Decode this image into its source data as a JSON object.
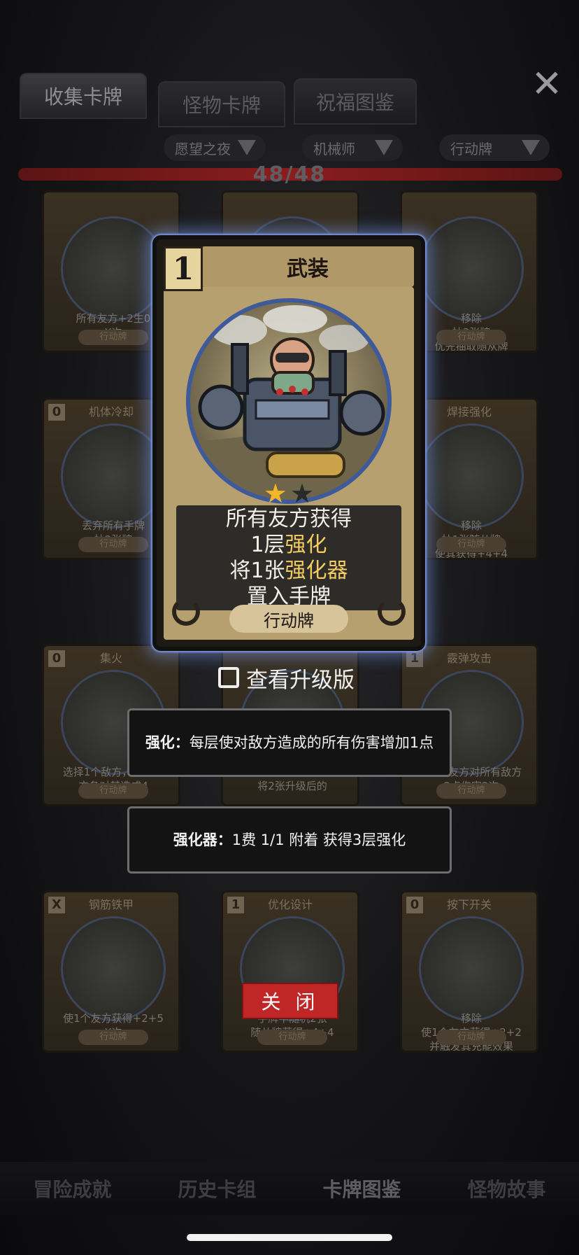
{
  "tabs": [
    {
      "label": "收集卡牌",
      "active": true
    },
    {
      "label": "怪物卡牌",
      "active": false
    },
    {
      "label": "祝福图鉴",
      "active": false
    }
  ],
  "filters": [
    "愿望之夜",
    "机械师",
    "行动牌"
  ],
  "collection_progress": "48/48",
  "background_cards": [
    {
      "cost": "",
      "name": "",
      "text": "所有友方+2生0\nX次",
      "type": "行动牌"
    },
    {
      "cost": "",
      "name": "",
      "text": "",
      "type": ""
    },
    {
      "cost": "",
      "name": "",
      "text": "移除\n抽3张牌\n优先抽取随从牌",
      "type": "行动牌"
    },
    {
      "cost": "0",
      "name": "机体冷却",
      "text": "丢弃所有手牌\n抽2张牌",
      "type": "行动牌"
    },
    {
      "cost": "",
      "name": "",
      "text": "",
      "type": ""
    },
    {
      "cost": "",
      "name": "焊接强化",
      "text": "移除\n抽1张随从牌\n使其获得+4+4",
      "type": "行动牌"
    },
    {
      "cost": "0",
      "name": "集火",
      "text": "选择1个敌方，所有友\n方各对其造成4",
      "type": "行动牌"
    },
    {
      "cost": "",
      "name": "",
      "text": "移除\n将2张升级后的",
      "type": ""
    },
    {
      "cost": "1",
      "name": "霰弹攻击",
      "text": "使1个友方对所有敌方\n2点伤害2次",
      "type": "行动牌"
    },
    {
      "cost": "X",
      "name": "钢筋铁甲",
      "text": "使1个友方获得+2+5\nX次",
      "type": "行动牌"
    },
    {
      "cost": "1",
      "name": "优化设计",
      "text": "手牌中随机2张\n随从牌获得+4+4",
      "type": "行动牌"
    },
    {
      "cost": "0",
      "name": "按下开关",
      "text": "移除\n使1个友方获得+2+2\n并触发其充能效果",
      "type": "行动牌"
    }
  ],
  "bottom_nav": [
    {
      "label": "冒险成就",
      "active": false
    },
    {
      "label": "历史卡组",
      "active": false
    },
    {
      "label": "卡牌图鉴",
      "active": true
    },
    {
      "label": "怪物故事",
      "active": false
    }
  ],
  "main_card": {
    "cost": "1",
    "name": "武装",
    "stars_filled": 1,
    "stars_total": 2,
    "text_line1": "所有友方获得",
    "text_line2_pre": "1层",
    "text_line2_hl": "强化",
    "text_line3_pre": "将1张",
    "text_line3_hl": "强化器",
    "text_line4": "置入手牌",
    "type": "行动牌",
    "accent_highlight": "#f4cc62",
    "glow_color": "#7c96d8"
  },
  "upgrade_toggle": {
    "label": "查看升级版",
    "checked": false
  },
  "tooltips": [
    {
      "term": "强化：",
      "desc": "每层使对敌方造成的所有伤害增加1点"
    },
    {
      "term": "强化器：",
      "desc": "1费 1/1 附着 获得3层强化"
    }
  ],
  "close_button_label": "关 闭",
  "icons": {
    "close": "close-x-icon",
    "filter_chevron": "chevron-down-icon",
    "star": "star-icon"
  }
}
